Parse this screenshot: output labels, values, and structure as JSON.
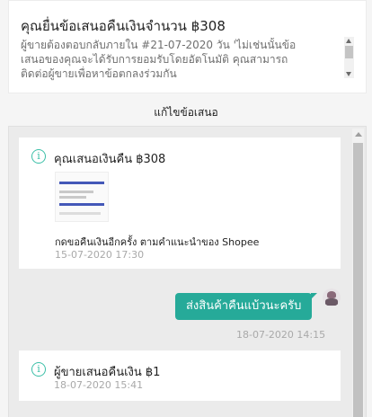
{
  "offer_card": {
    "title": "คุณยื่นข้อเสนอคืนเงินจำนวน ฿308",
    "text_lines": [
      "ผู้ขายต้องตอบกลับภายใน #21-07-2020 วัน 'ไม่เช่นนั้นข้อ",
      "เสนอของคุณจะได้รับการยอมรับโดยอัตโนมัติ คุณสามารถ",
      "ติดต่อผู้ขายเพื่อหาข้อตกลงร่วมกัน"
    ]
  },
  "edit_offer_label": "แก้ไขข้อเสนอ",
  "thread": {
    "buyer_offer": {
      "title": "คุณเสนอเงินคืน ฿308",
      "note": "กดขอคืนเงินอีกครั้ง ตามคำแนะนำของ Shopee",
      "time": "15-07-2020 17:30"
    },
    "chat_message": {
      "text": "ส่งสินค้าคืนแบ้วนะครับ",
      "time": "18-07-2020 14:15"
    },
    "seller_offer": {
      "title": "ผู้ขายเสนอคืนเงิน ฿1",
      "time": "18-07-2020 15:41"
    }
  },
  "colors": {
    "accent": "#26aa99",
    "info_icon": "#3bbfa7",
    "muted_text": "#a9a9a9",
    "panel_bg": "#ebebeb"
  },
  "icons": {
    "info": "info-circle-icon",
    "avatar": "user-avatar-icon"
  }
}
